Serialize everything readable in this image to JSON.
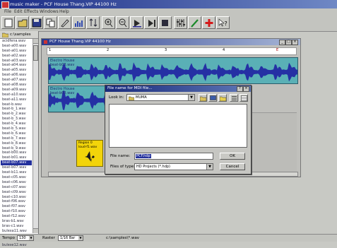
{
  "app": {
    "title": "music maker - PCF House Thang.VIP 44100 Hz"
  },
  "menu": [
    "File",
    "Edit",
    "Effects",
    "Windows",
    "Help"
  ],
  "sidebar": {
    "path": "c:\\samples",
    "items": [
      "acidfena.wav",
      "beat-a00.wav",
      "beat-a01.wav",
      "beat-a02.wav",
      "beat-a03.wav",
      "beat-a04.wav",
      "beat-a05.wav",
      "beat-a06.wav",
      "beat-a07.wav",
      "beat-a08.wav",
      "beat-a09.wav",
      "beat-a10.wav",
      "beat-a11.wav",
      "beat-b.wav",
      "beat-b_1.wav",
      "beat-b_2.wav",
      "beat-b_3.wav",
      "beat-b_4.wav",
      "beat-b_5.wav",
      "beat-b_6.wav",
      "beat-b_7.wav",
      "beat-b_8.wav",
      "beat-b_9.wav",
      "beat-b00.wav",
      "beat-b01.wav",
      "beat-b07.wav",
      "beat-b07.wav",
      "beat-b11.wav",
      "beat-c05.wav",
      "beat-c06.wav",
      "beat-c07.wav",
      "beat-c09.wav",
      "beat-c10.wav",
      "beat-f06.wav",
      "beat-f07.wav",
      "beat-f10.wav",
      "beat-f12.wav",
      "bras-b1.wav",
      "bras-c1.wav",
      "bulexa11.wav",
      "bulexa10.wav",
      "bulexe11.wav",
      "bulexe12.wav"
    ],
    "selected_index": 25
  },
  "project": {
    "title": "PCF House Thang.VIP 44100 Hz",
    "ruler": [
      "1",
      "2",
      "3",
      "4",
      "E"
    ],
    "tracks": [
      {
        "name": "Electro House",
        "file": "beat-b03.wav"
      },
      {
        "name": "Electro House",
        "file": "beat-b03.wav"
      }
    ],
    "region": {
      "name": "Region 0",
      "file": "loud-f1.wav"
    }
  },
  "dialog": {
    "title": "File name for MDI file...",
    "look_in_label": "Look in:",
    "look_in_value": "MUMA",
    "filename_label": "File name:",
    "filename_value": "PCF.hdp",
    "filetype_label": "Files of type:",
    "filetype_value": "HD Projects (*.hdp)",
    "ok": "OK",
    "cancel": "Cancel"
  },
  "status": {
    "tempo_label": "Tempo",
    "tempo_value": "130",
    "raster_label": "Raster",
    "raster_value": "1/16 Bar",
    "path": "c:\\samples\\*.wav"
  }
}
